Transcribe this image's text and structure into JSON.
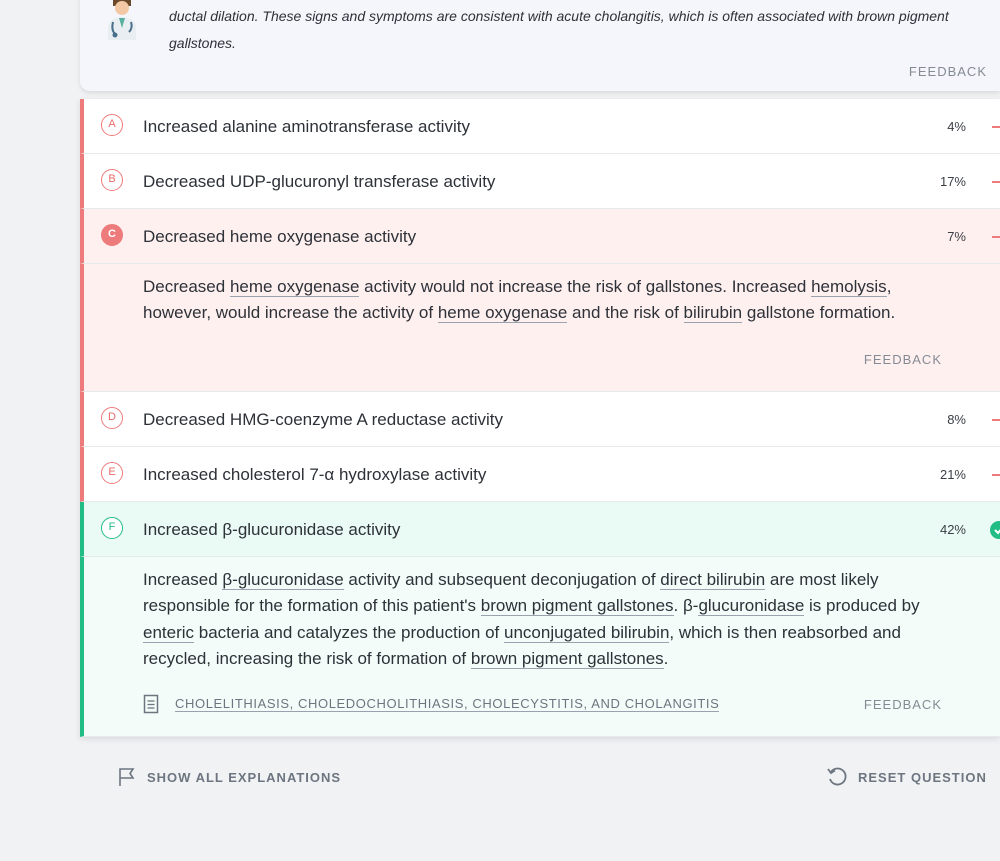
{
  "top_explanation": {
    "text_line1": "ductal dilation. These signs and symptoms are consistent with acute cholangitis, which is often associated with brown pigment",
    "text_line2": "gallstones.",
    "feedback_label": "FEEDBACK"
  },
  "answers": [
    {
      "letter": "A",
      "text": "Increased alanine aminotransferase activity",
      "percent": "4%",
      "state": "default"
    },
    {
      "letter": "B",
      "text": "Decreased UDP-glucuronyl transferase activity",
      "percent": "17%",
      "state": "default"
    },
    {
      "letter": "C",
      "text": "Decreased heme oxygenase activity",
      "percent": "7%",
      "state": "selected-incorrect"
    },
    {
      "letter": "D",
      "text": "Decreased HMG-coenzyme A reductase activity",
      "percent": "8%",
      "state": "default"
    },
    {
      "letter": "E",
      "text": "Increased cholesterol 7-α hydroxylase activity",
      "percent": "21%",
      "state": "default"
    },
    {
      "letter": "F",
      "text": "Increased β-glucuronidase activity",
      "percent": "42%",
      "state": "correct"
    }
  ],
  "explanation_c": {
    "seg1": "Decreased ",
    "link1": "heme oxygenase",
    "seg2": " activity would not increase the risk of gallstones. Increased ",
    "link2": "hemolysis",
    "seg3": ",",
    "seg4": "however, would increase the activity of ",
    "link3": "heme oxygenase",
    "seg5": " and the risk of ",
    "link4": "bilirubin",
    "seg6": " gallstone formation.",
    "feedback_label": "FEEDBACK"
  },
  "explanation_f": {
    "seg1": "Increased ",
    "link1": "β-glucuronidase",
    "seg2": " activity and subsequent deconjugation of ",
    "link2": "direct bilirubin",
    "seg3": " are most likely",
    "seg4": "responsible for the formation of this patient's ",
    "link3": "brown pigment gallstones",
    "seg5": ". β-",
    "link4": "glucuronidase",
    "seg6": " is produced by",
    "link5": "enteric",
    "seg7": " bacteria and catalyzes the production of ",
    "link6": "unconjugated bilirubin",
    "seg8": ", which is then reabsorbed and",
    "seg9": "recycled, increasing the risk of formation of ",
    "link7": "brown pigment gallstones",
    "seg10": ".",
    "topic_label": "CHOLELITHIASIS, CHOLEDOCHOLITHIASIS, CHOLECYSTITIS, AND CHOLANGITIS",
    "feedback_label": "FEEDBACK"
  },
  "bottom": {
    "show_all_label": "SHOW ALL EXPLANATIONS",
    "reset_label": "RESET QUESTION"
  },
  "colors": {
    "incorrect": "#ee7b7b",
    "correct": "#22bd85",
    "background": "#f1f2f4"
  },
  "icons": [
    "doctor-avatar-icon",
    "document-icon",
    "flag-icon",
    "reset-icon",
    "checkmark-icon"
  ]
}
